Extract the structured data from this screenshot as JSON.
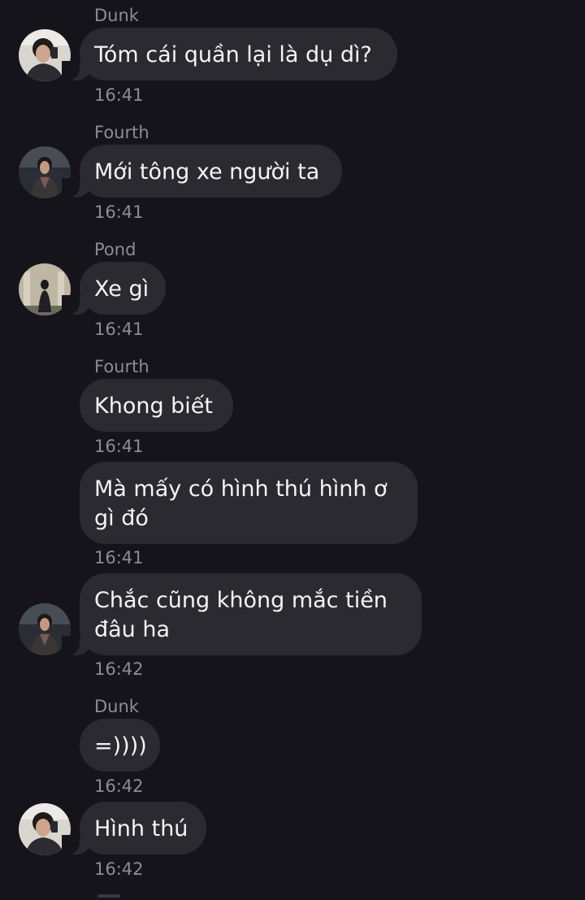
{
  "messages": [
    {
      "sender": "Dunk",
      "text": "Tóm cái quần lại là dụ dì?",
      "time": "16:41"
    },
    {
      "sender": "Fourth",
      "text": "Mới tông xe người ta",
      "time": "16:41"
    },
    {
      "sender": "Pond",
      "text": "Xe gì",
      "time": "16:41"
    },
    {
      "sender": "Fourth",
      "text": "Khong biết",
      "time": "16:41"
    },
    {
      "sender": "",
      "lines": [
        "Mà mấy có hình thú hình ơ",
        "gì đó"
      ],
      "time": "16:41"
    },
    {
      "sender": "",
      "lines": [
        "Chắc cũng không mắc tiền",
        "đâu ha"
      ],
      "time": "16:42"
    },
    {
      "sender": "Dunk",
      "text": "=))))",
      "time": "16:42"
    },
    {
      "sender": "",
      "text": "Hình thú",
      "time": "16:42"
    }
  ],
  "avatars": {
    "dunk": "avatar-dunk",
    "fourth": "avatar-fourth",
    "pond": "avatar-pond"
  },
  "colors": {
    "background": "#16141b",
    "bubble": "#2b2a30",
    "text": "#f4f3f6",
    "meta": "#8d8b93"
  }
}
